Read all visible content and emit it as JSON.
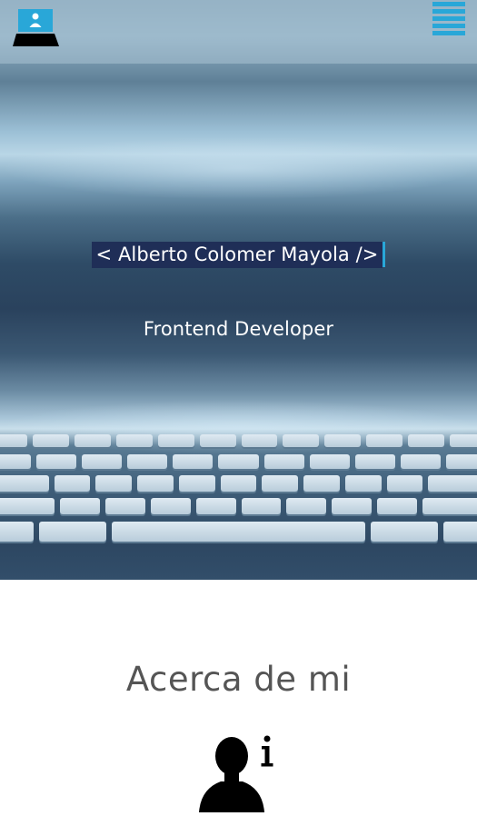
{
  "hero": {
    "title": "< Alberto Colomer Mayola />",
    "subtitle": "Frontend Developer"
  },
  "about": {
    "title": "Acerca de mi",
    "icon": "person-info-icon"
  },
  "navbar": {
    "logo_icon": "laptop-user-icon",
    "menu_icon": "hamburger-menu-icon"
  },
  "colors": {
    "accent": "#29a7d8",
    "title_bg": "#1f2e57",
    "heading_text": "#555555"
  }
}
